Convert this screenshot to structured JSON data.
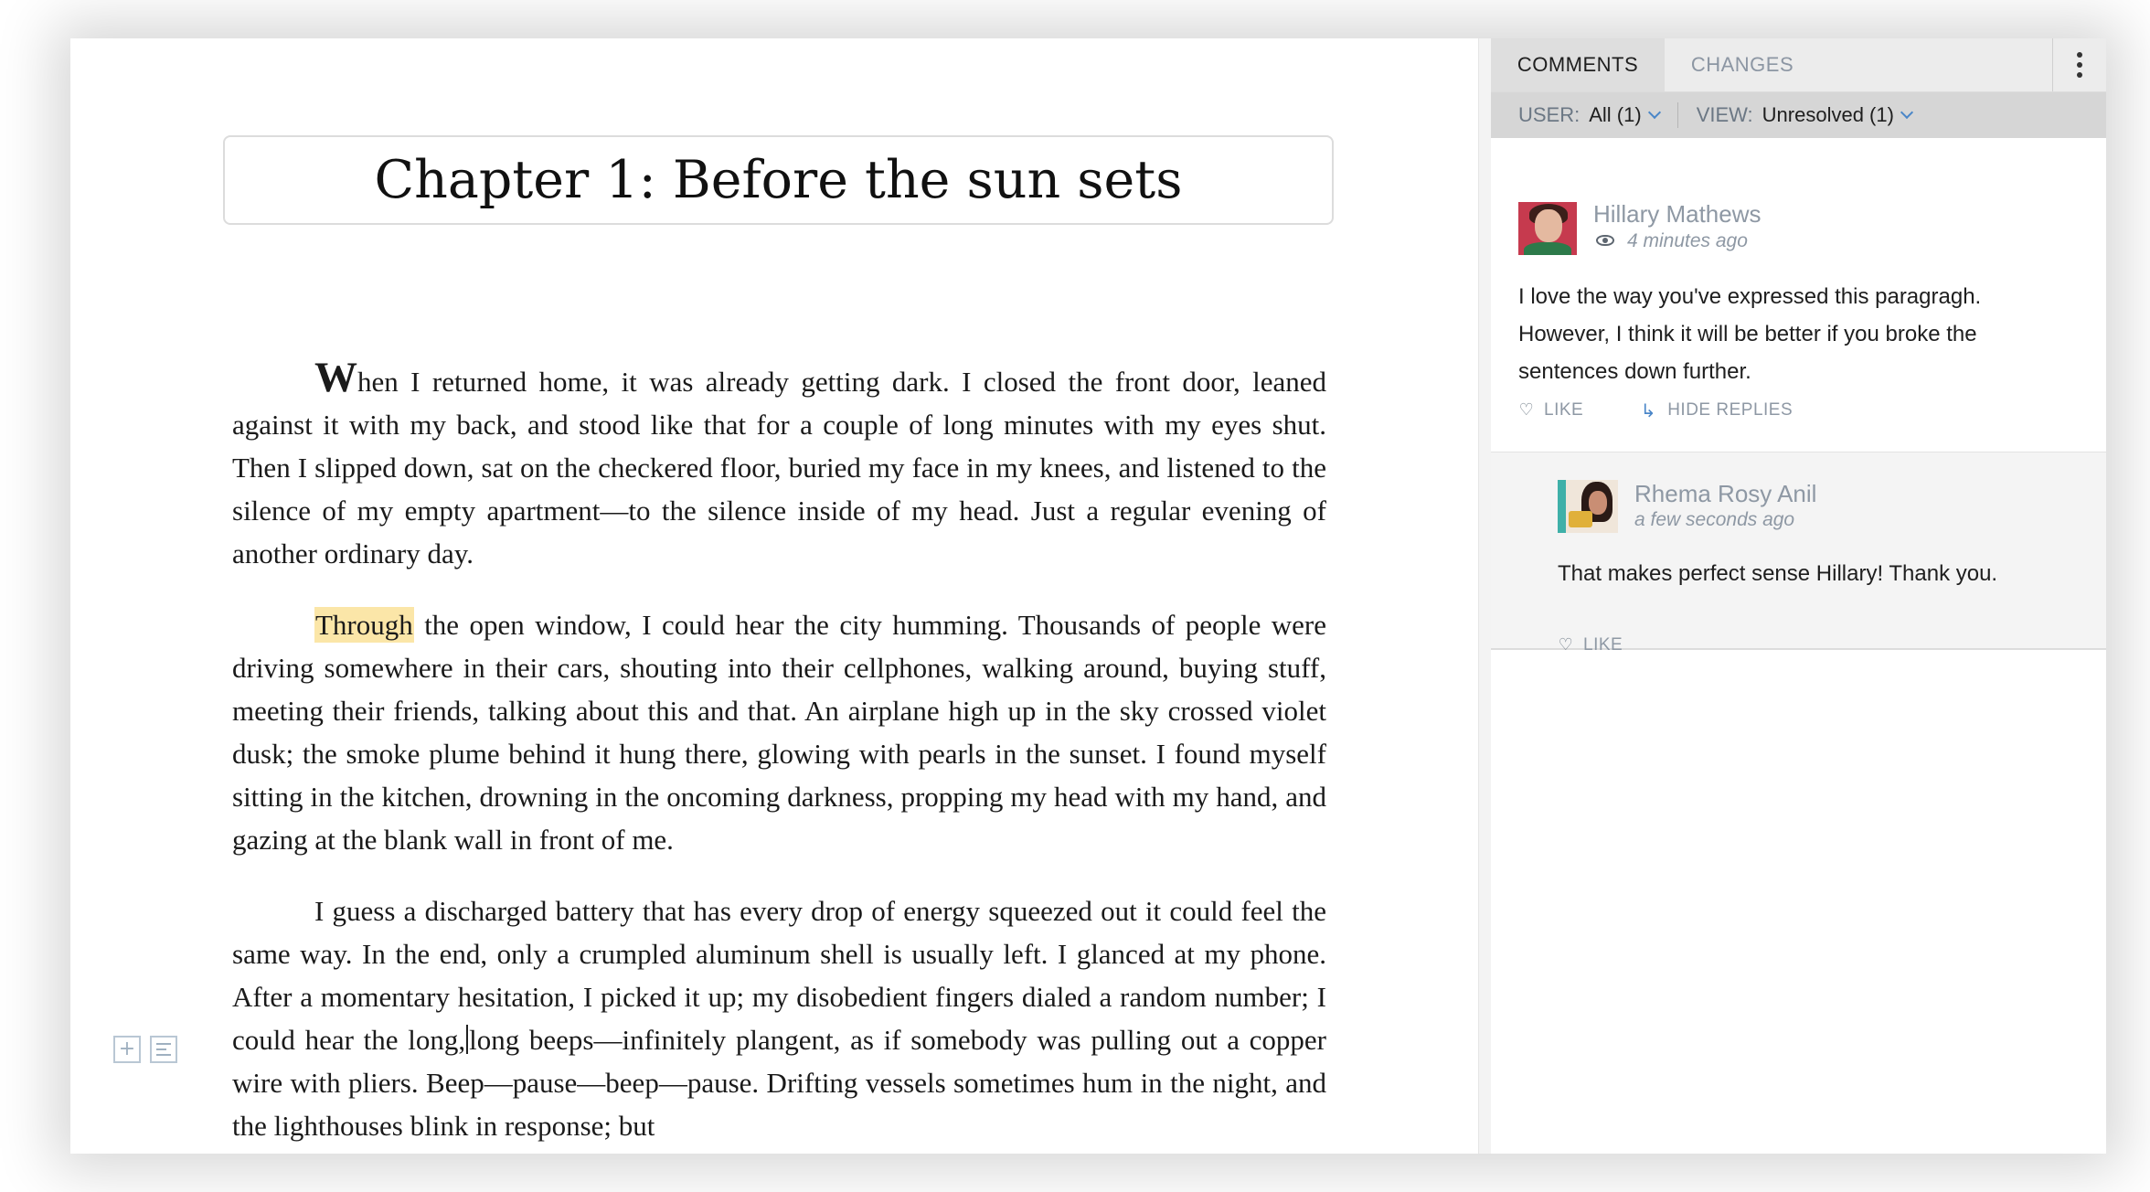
{
  "document": {
    "title": "Chapter 1: Before the sun sets",
    "p1_dropcap": "W",
    "p1_rest": "hen I returned home, it was already getting dark. I closed the front door, leaned against it with my back, and stood like that for a couple of long minutes with my eyes shut. Then I slipped down, sat on the checkered floor, buried my face in my knees, and listened to the silence of my empty apartment—to the silence inside of my head. Just a regular evening of another ordinary day.",
    "p2_highlight": "Through",
    "p2_rest": " the open window, I could hear the city humming. Thousands of people were driving somewhere in their cars, shouting into their cellphones, walking around, buying stuff, meeting their friends, talking about this and that. An airplane high up in the sky crossed violet dusk; the smoke plume behind it hung there, glowing with pearls in the sunset. I found myself sitting in the kitchen, drowning in the oncoming darkness, propping my head with my hand, and gazing at the blank wall in front of me.",
    "p3_before_caret": "I guess a discharged battery that has every drop of energy squeezed out it could feel the same way. In the end, only a crumpled aluminum shell is usually left. I glanced at my phone. After a momentary hesitation, I picked it up; my disobedient fingers dialed a random number; I could hear the long,",
    "p3_after_caret": "long beeps—infinitely plangent, as if somebody was pulling out a copper wire with pliers. Beep—pause—beep—pause. Drifting vessels sometimes hum in the night, and the lighthouses blink in response; but",
    "side_tools": {
      "add_icon": "plus-square-icon",
      "comment_icon": "lines-square-icon"
    }
  },
  "panel": {
    "tabs": [
      "COMMENTS",
      "CHANGES"
    ],
    "active_tab": "COMMENTS",
    "filter": {
      "user_label": "USER:",
      "user_value": "All (1)",
      "view_label": "VIEW:",
      "view_value": "Unresolved (1)"
    },
    "comments": [
      {
        "author": "Hillary Mathews",
        "time": "4 minutes ago",
        "text": "I love the way you've expressed this paragragh. However, I think it will be better if you broke the sentences down further.",
        "like_label": "LIKE",
        "replies_label": "HIDE REPLIES"
      },
      {
        "author": "Rhema Rosy Anil",
        "time": "a few seconds ago",
        "text": "That makes perfect sense Hillary! Thank you.",
        "like_label": "LIKE"
      }
    ]
  },
  "colors": {
    "highlight": "#fbe6a8",
    "accent": "#4a86c8",
    "muted_text": "#8e98a4",
    "reply_background": "#f4f4f4"
  }
}
